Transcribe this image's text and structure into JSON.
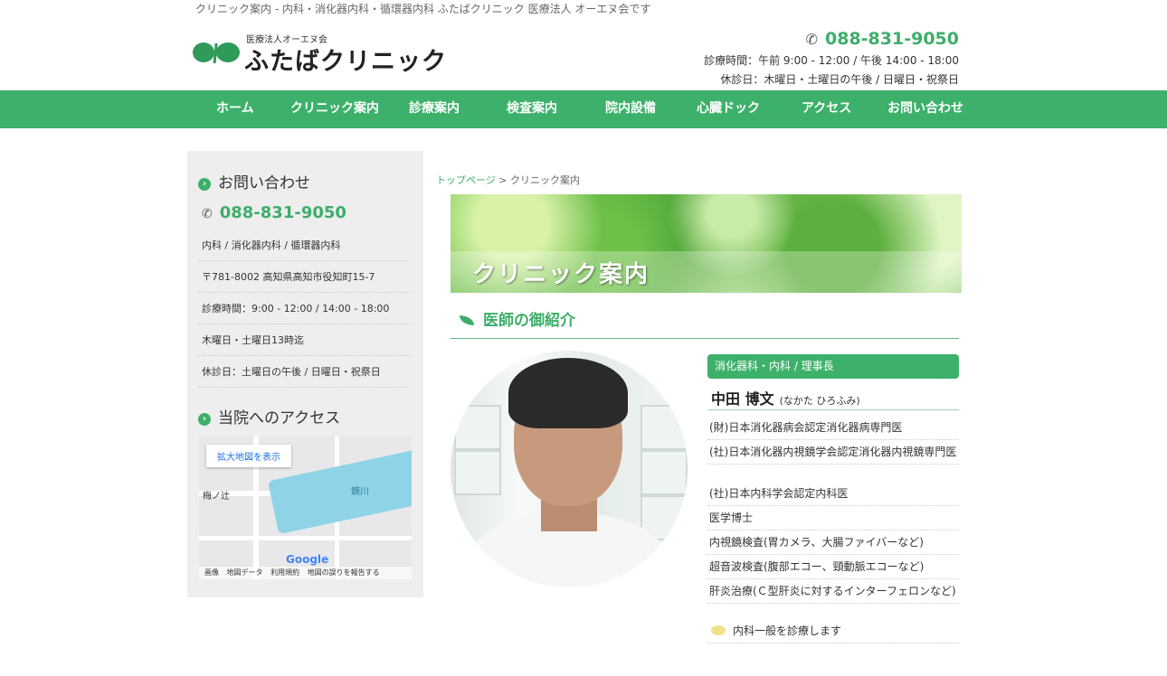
{
  "header": {
    "tagline": "クリニック案内 - 内科・消化器内科・循環器内科 ふたばクリニック 医療法人 オーエヌ会です",
    "logo_sub": "医療法人オーエヌ会",
    "logo_name": "ふたばクリニック",
    "phone": "088-831-9050",
    "hours": "診療時間：午前 9:00 - 12:00 / 午後 14:00 - 18:00",
    "closed": "休診日：木曜日・土曜日の午後 / 日曜日・祝祭日"
  },
  "nav": {
    "items": [
      "ホーム",
      "クリニック案内",
      "診療案内",
      "検査案内",
      "院内設備",
      "心臓ドック",
      "アクセス",
      "お問い合わせ"
    ]
  },
  "sidebar": {
    "contact_heading": "お問い合わせ",
    "phone": "088-831-9050",
    "rows": [
      "内科 / 消化器内科 / 循環器内科",
      "〒781-8002 高知県高知市役知町15-7",
      "診療時間：9:00 - 12:00 / 14:00 - 18:00",
      "木曜日・土曜日13時迄",
      "休診日：土曜日の午後 / 日曜日・祝祭日"
    ],
    "access_heading": "当院へのアクセス",
    "map": {
      "enlarge": "拡大地図を表示",
      "labels": [
        "梅ノ辻",
        "鏡川"
      ],
      "google": "Google",
      "footer": [
        "画像",
        "地図データ",
        "利用規約",
        "地図の誤りを報告する"
      ]
    }
  },
  "main": {
    "breadcrumb_home": "トップページ",
    "breadcrumb_sep": " > ",
    "breadcrumb_current": "クリニック案内",
    "banner_title": "クリニック案内",
    "section_title": "医師の御紹介",
    "doctor": {
      "dept": "消化器科・内科 / 理事長",
      "name": "中田 博文",
      "reading": "(なかた ひろふみ)",
      "credentials": [
        "(財)日本消化器病会認定消化器病専門医",
        "(社)日本消化器内視鏡学会認定消化器内視鏡専門医",
        "(社)日本内科学会認定内科医",
        "医学博士",
        "内視鏡検査(胃カメラ、大腸ファイバーなど)",
        "超音波検査(腹部エコー、頸動脈エコーなど)",
        "肝炎治療(Ｃ型肝炎に対するインターフェロンなど)"
      ],
      "note": "内科一般を診療します"
    }
  },
  "colors": {
    "brand_green": "#3db16b",
    "text": "#333333"
  },
  "icons": [
    "phone-icon",
    "chevron-right-icon",
    "leaf-icon",
    "speech-bubble-icon"
  ]
}
